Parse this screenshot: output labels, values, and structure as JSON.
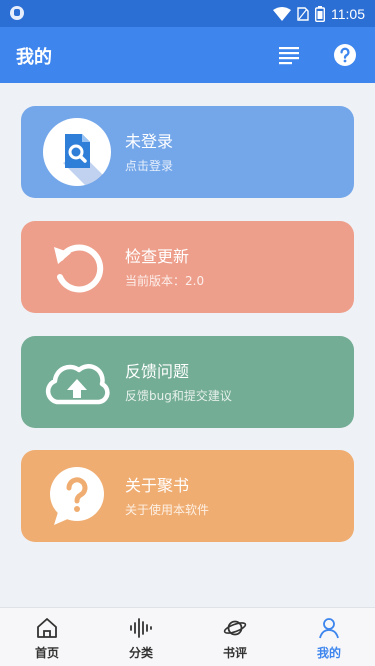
{
  "status_bar": {
    "time": "11:05",
    "icons": [
      "shield-icon",
      "wifi-icon",
      "sim-icon",
      "battery-icon"
    ]
  },
  "app_bar": {
    "title": "我的",
    "actions": [
      "list-menu-icon",
      "help-icon"
    ]
  },
  "cards": {
    "login": {
      "title": "未登录",
      "subtitle": "点击登录",
      "icon": "document-search-icon",
      "color": "#74a7ea"
    },
    "update": {
      "title": "检查更新",
      "subtitle": "当前版本：2.0",
      "icon": "refresh-icon",
      "color": "#ee9f8b"
    },
    "feedback": {
      "title": "反馈问题",
      "subtitle": "反馈bug和提交建议",
      "icon": "cloud-upload-icon",
      "color": "#74ad95"
    },
    "about": {
      "title": "关于聚书",
      "subtitle": "关于使用本软件",
      "icon": "question-bubble-icon",
      "color": "#f0ad71"
    }
  },
  "bottom_nav": {
    "items": [
      {
        "label": "首页",
        "icon": "home-icon"
      },
      {
        "label": "分类",
        "icon": "soundwave-icon"
      },
      {
        "label": "书评",
        "icon": "planet-icon"
      },
      {
        "label": "我的",
        "icon": "user-icon"
      }
    ],
    "active_index": 3,
    "active_color": "#3e86ee"
  }
}
